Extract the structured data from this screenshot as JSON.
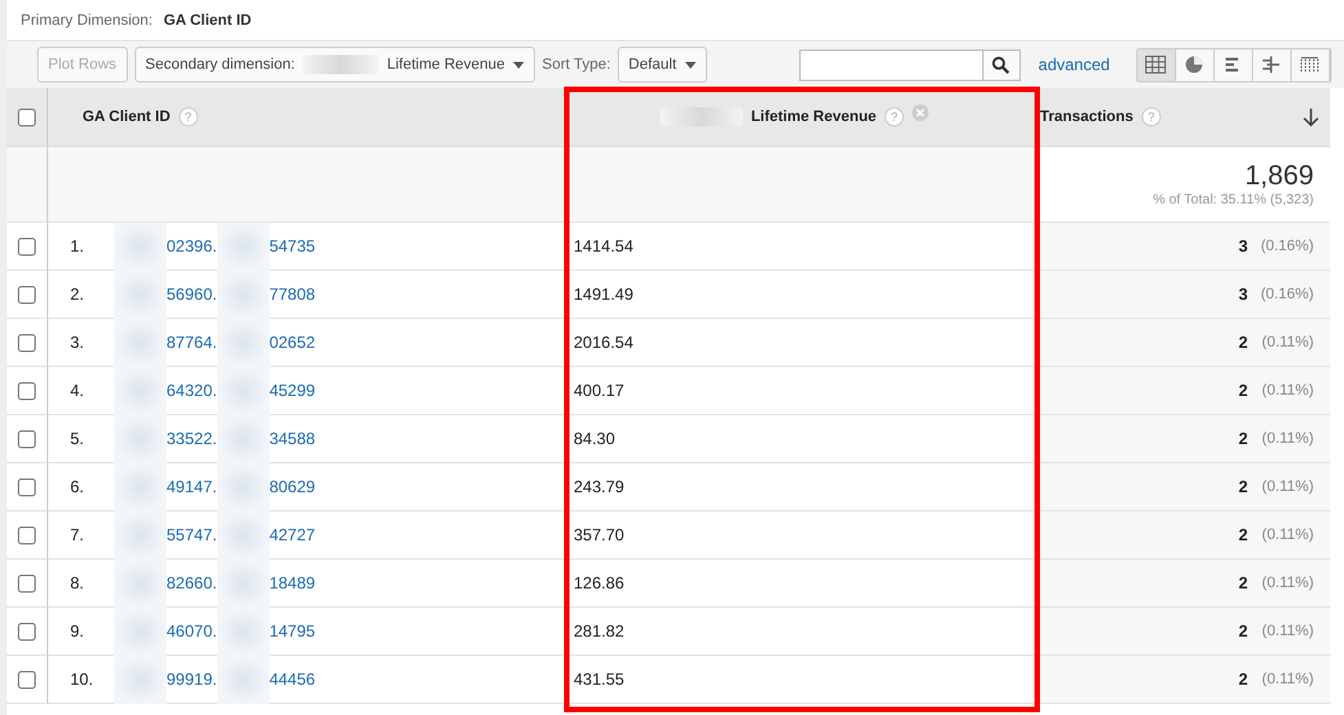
{
  "primary_dimension": {
    "label": "Primary Dimension:",
    "value": "GA Client ID"
  },
  "toolbar": {
    "plot_rows": "Plot Rows",
    "secondary_dimension": {
      "label": "Secondary dimension:",
      "value": "Lifetime Revenue"
    },
    "sort_type": {
      "label": "Sort Type:",
      "value": "Default"
    },
    "advanced": "advanced",
    "views": [
      {
        "kind": "table",
        "selected": true
      },
      {
        "kind": "pie",
        "selected": false
      },
      {
        "kind": "bars",
        "selected": false
      },
      {
        "kind": "compare",
        "selected": false
      },
      {
        "kind": "pivot",
        "selected": false
      }
    ]
  },
  "table": {
    "select_all": {
      "checked": false
    },
    "columns": [
      {
        "label": "GA Client ID",
        "help": "?"
      },
      {
        "label": "Lifetime Revenue",
        "help": "?"
      },
      {
        "label": "Transactions",
        "help": "?",
        "sorted": true
      }
    ],
    "totals": {
      "value": "1,869",
      "note": "% of Total: 35.11% (5,323)"
    },
    "rows": [
      {
        "index": "1.",
        "id_part_1": "02396.",
        "id_part_2": "54735",
        "revenue": "1414.54",
        "transactions": "3",
        "share": "(0.16%)",
        "checked": false
      },
      {
        "index": "2.",
        "id_part_1": "56960.",
        "id_part_2": "77808",
        "revenue": "1491.49",
        "transactions": "3",
        "share": "(0.16%)",
        "checked": false
      },
      {
        "index": "3.",
        "id_part_1": "87764.",
        "id_part_2": "02652",
        "revenue": "2016.54",
        "transactions": "2",
        "share": "(0.11%)",
        "checked": false
      },
      {
        "index": "4.",
        "id_part_1": "64320.",
        "id_part_2": "45299",
        "revenue": "400.17",
        "transactions": "2",
        "share": "(0.11%)",
        "checked": false
      },
      {
        "index": "5.",
        "id_part_1": "33522.",
        "id_part_2": "34588",
        "revenue": "84.30",
        "transactions": "2",
        "share": "(0.11%)",
        "checked": false
      },
      {
        "index": "6.",
        "id_part_1": "49147.",
        "id_part_2": "80629",
        "revenue": "243.79",
        "transactions": "2",
        "share": "(0.11%)",
        "checked": false
      },
      {
        "index": "7.",
        "id_part_1": "55747.",
        "id_part_2": "42727",
        "revenue": "357.70",
        "transactions": "2",
        "share": "(0.11%)",
        "checked": false
      },
      {
        "index": "8.",
        "id_part_1": "82660.",
        "id_part_2": "18489",
        "revenue": "126.86",
        "transactions": "2",
        "share": "(0.11%)",
        "checked": false
      },
      {
        "index": "9.",
        "id_part_1": "46070.",
        "id_part_2": "14795",
        "revenue": "281.82",
        "transactions": "2",
        "share": "(0.11%)",
        "checked": false
      },
      {
        "index": "10.",
        "id_part_1": "99919.",
        "id_part_2": "44456",
        "revenue": "431.55",
        "transactions": "2",
        "share": "(0.11%)",
        "checked": false
      }
    ]
  }
}
